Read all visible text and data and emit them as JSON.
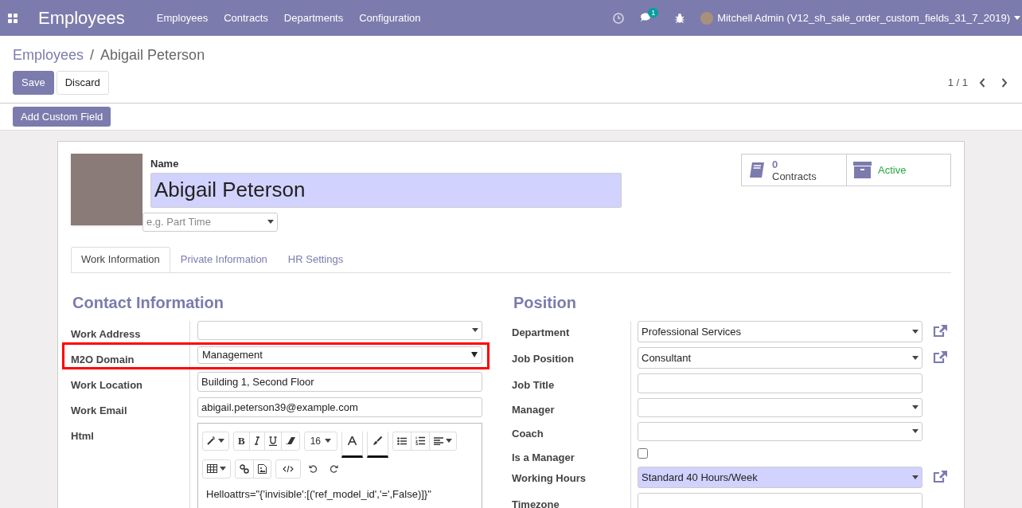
{
  "navbar": {
    "app_title": "Employees",
    "menu": [
      {
        "label": "Employees"
      },
      {
        "label": "Contracts"
      },
      {
        "label": "Departments"
      },
      {
        "label": "Configuration"
      }
    ],
    "message_count": "1",
    "user": "Mitchell Admin (V12_sh_sale_order_custom_fields_31_7_2019)"
  },
  "breadcrumb_separator": "/",
  "breadcrumb": [
    {
      "label": "Employees",
      "kind": "link"
    },
    {
      "label": "Abigail Peterson",
      "kind": "current"
    }
  ],
  "buttons": [
    {
      "label": "Save",
      "kind": "primary"
    },
    {
      "label": "Discard",
      "kind": "secondary"
    }
  ],
  "pager": "1 / 1",
  "custom_field_button": "Add Custom Field",
  "employee": {
    "name_label": "Name",
    "name": "Abigail Peterson",
    "tags_placeholder": "e.g. Part Time"
  },
  "smart_buttons": [
    {
      "kind": "contracts",
      "count": "0",
      "label": "Contracts"
    },
    {
      "kind": "active",
      "label": "Active"
    }
  ],
  "tabs": [
    {
      "label": "Work Information",
      "selected": true
    },
    {
      "label": "Private Information",
      "selected": false
    },
    {
      "label": "HR Settings",
      "selected": false
    }
  ],
  "contact": {
    "title": "Contact Information",
    "fields": [
      {
        "label": "Work Address",
        "kind": "select",
        "highlighted": false
      },
      {
        "label": "M2O Domain",
        "kind": "native-select",
        "value": "Management",
        "highlighted": true
      },
      {
        "label": "Work Location",
        "kind": "input",
        "value": "Building 1, Second Floor",
        "highlighted": false
      },
      {
        "label": "Work Email",
        "kind": "input",
        "value": "abigail.peterson39@example.com",
        "highlighted": false
      },
      {
        "label": "Html",
        "kind": "html",
        "format_glyphs": [
          "B"
        ],
        "font_size": "16",
        "value": "Helloattrs=\"{'invisible':[('ref_model_id','=',False)]}\"",
        "highlighted": false
      }
    ]
  },
  "position": {
    "title": "Position",
    "fields": [
      {
        "label": "Department",
        "kind": "select",
        "value": "Professional Services",
        "external": true,
        "required": false
      },
      {
        "label": "Job Position",
        "kind": "select",
        "value": "Consultant",
        "external": true,
        "required": false
      },
      {
        "label": "Job Title",
        "kind": "input",
        "external": false,
        "required": false
      },
      {
        "label": "Manager",
        "kind": "select",
        "external": false,
        "required": false
      },
      {
        "label": "Coach",
        "kind": "select",
        "external": false,
        "required": false
      },
      {
        "label": "Is a Manager",
        "kind": "checkbox",
        "checked": false,
        "external": false
      },
      {
        "label": "Working Hours",
        "kind": "select",
        "value": "Standard 40 Hours/Week",
        "external": true,
        "required": true
      },
      {
        "label": "Timezone",
        "kind": "input",
        "external": false,
        "required": false
      }
    ]
  }
}
